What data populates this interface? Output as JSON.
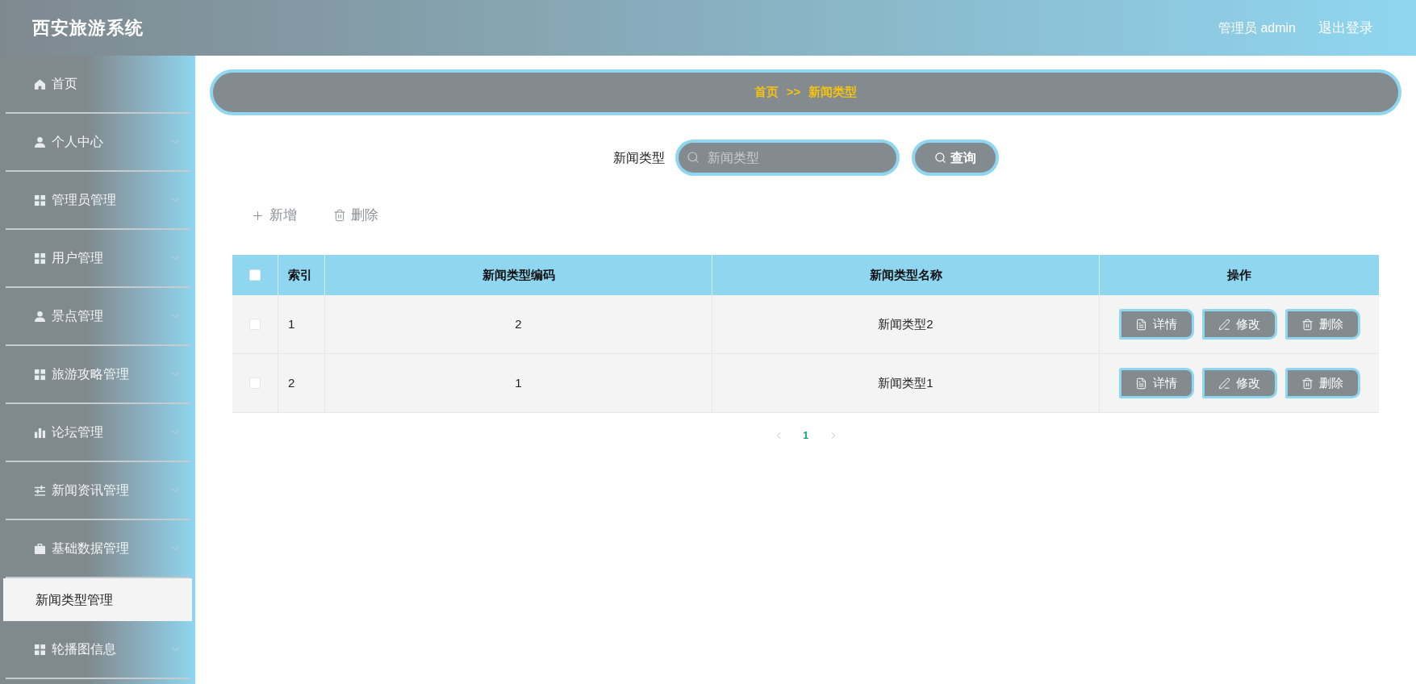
{
  "header": {
    "title": "西安旅游系统",
    "user": "管理员 admin",
    "logout": "退出登录"
  },
  "sidebar": {
    "items": [
      {
        "label": "首页",
        "kind": "link",
        "selected": false
      },
      {
        "label": "个人中心",
        "kind": "submenu",
        "selected": false
      },
      {
        "label": "管理员管理",
        "kind": "submenu",
        "selected": false
      },
      {
        "label": "用户管理",
        "kind": "submenu",
        "selected": false
      },
      {
        "label": "景点管理",
        "kind": "submenu",
        "selected": false
      },
      {
        "label": "旅游攻略管理",
        "kind": "submenu",
        "selected": false
      },
      {
        "label": "论坛管理",
        "kind": "submenu",
        "selected": false
      },
      {
        "label": "新闻资讯管理",
        "kind": "submenu",
        "selected": false
      },
      {
        "label": "基础数据管理",
        "kind": "submenu",
        "selected": false,
        "children": [
          {
            "label": "新闻类型管理",
            "selected": true
          }
        ]
      },
      {
        "label": "轮播图信息",
        "kind": "submenu",
        "selected": false
      }
    ]
  },
  "breadcrumb": {
    "home": "首页",
    "separator": ">>",
    "current": "新闻类型"
  },
  "search": {
    "label": "新闻类型",
    "placeholder": "新闻类型",
    "button": "查询"
  },
  "toolbar": [
    {
      "label": "新增",
      "kind": "add"
    },
    {
      "label": "删除",
      "kind": "delete"
    }
  ],
  "table": {
    "select_all": {
      "checked": false
    },
    "columns": [
      "索引",
      "新闻类型编码",
      "新闻类型名称",
      "操作"
    ],
    "rows": [
      {
        "checked": false,
        "index": "1",
        "code": "2",
        "name": "新闻类型2",
        "actions": [
          {
            "label": "详情",
            "kind": "detail"
          },
          {
            "label": "修改",
            "kind": "edit"
          },
          {
            "label": "删除",
            "kind": "delete"
          }
        ]
      },
      {
        "checked": false,
        "index": "2",
        "code": "1",
        "name": "新闻类型1",
        "actions": [
          {
            "label": "详情",
            "kind": "detail"
          },
          {
            "label": "修改",
            "kind": "edit"
          },
          {
            "label": "删除",
            "kind": "delete"
          }
        ]
      }
    ]
  },
  "pagination": {
    "prev": {
      "disabled": true
    },
    "pages": [
      {
        "label": "1",
        "selected": true
      }
    ],
    "next": {
      "disabled": true
    }
  }
}
